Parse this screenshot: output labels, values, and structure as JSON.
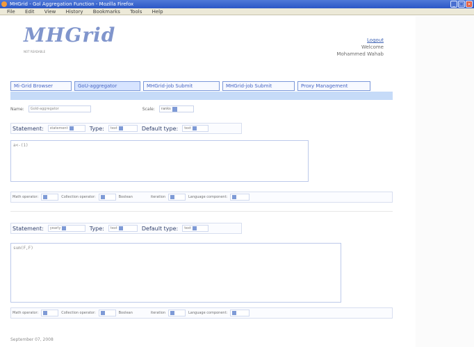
{
  "window": {
    "title": "MHGrid - Gol Aggregation Function - Mozilla Firefox",
    "menus": [
      "File",
      "Edit",
      "View",
      "History",
      "Bookmarks",
      "Tools",
      "Help"
    ]
  },
  "header": {
    "brand": "MHGrid",
    "tagline": "NOT READABLE",
    "logout": "Logout",
    "welcome": "Welcome",
    "user": "Mohammed Wahab"
  },
  "tabs": [
    {
      "label": "Mi-Grid Browser"
    },
    {
      "label": "GoU-aggregator"
    },
    {
      "label": "MHGrid-job Submit"
    },
    {
      "label": "MHGrid-job Submit"
    },
    {
      "label": "Proxy Management"
    }
  ],
  "form": {
    "name_label": "Name:",
    "name_value": "Gold-aggregator",
    "scale_label": "Scale:",
    "scale_value": "ranks"
  },
  "section1": {
    "statement": "Statement:",
    "statement_value": "statement",
    "type": "Type:",
    "type_value": "text",
    "default_type": "Default type:",
    "default_value": "text",
    "code": "a<-(1)"
  },
  "operator_bar": {
    "math": "Math operator:",
    "collection": "Collection operator:",
    "boolean": "Boolean",
    "iteration": "iteration",
    "language": "Language component:"
  },
  "section2": {
    "statement": "Statement:",
    "statement_value": "yearly",
    "type": "Type:",
    "type_value": "text",
    "default_type": "Default type:",
    "default_value": "text",
    "code": "sum(F,F)"
  },
  "footer": {
    "date": "September 07, 2008"
  }
}
